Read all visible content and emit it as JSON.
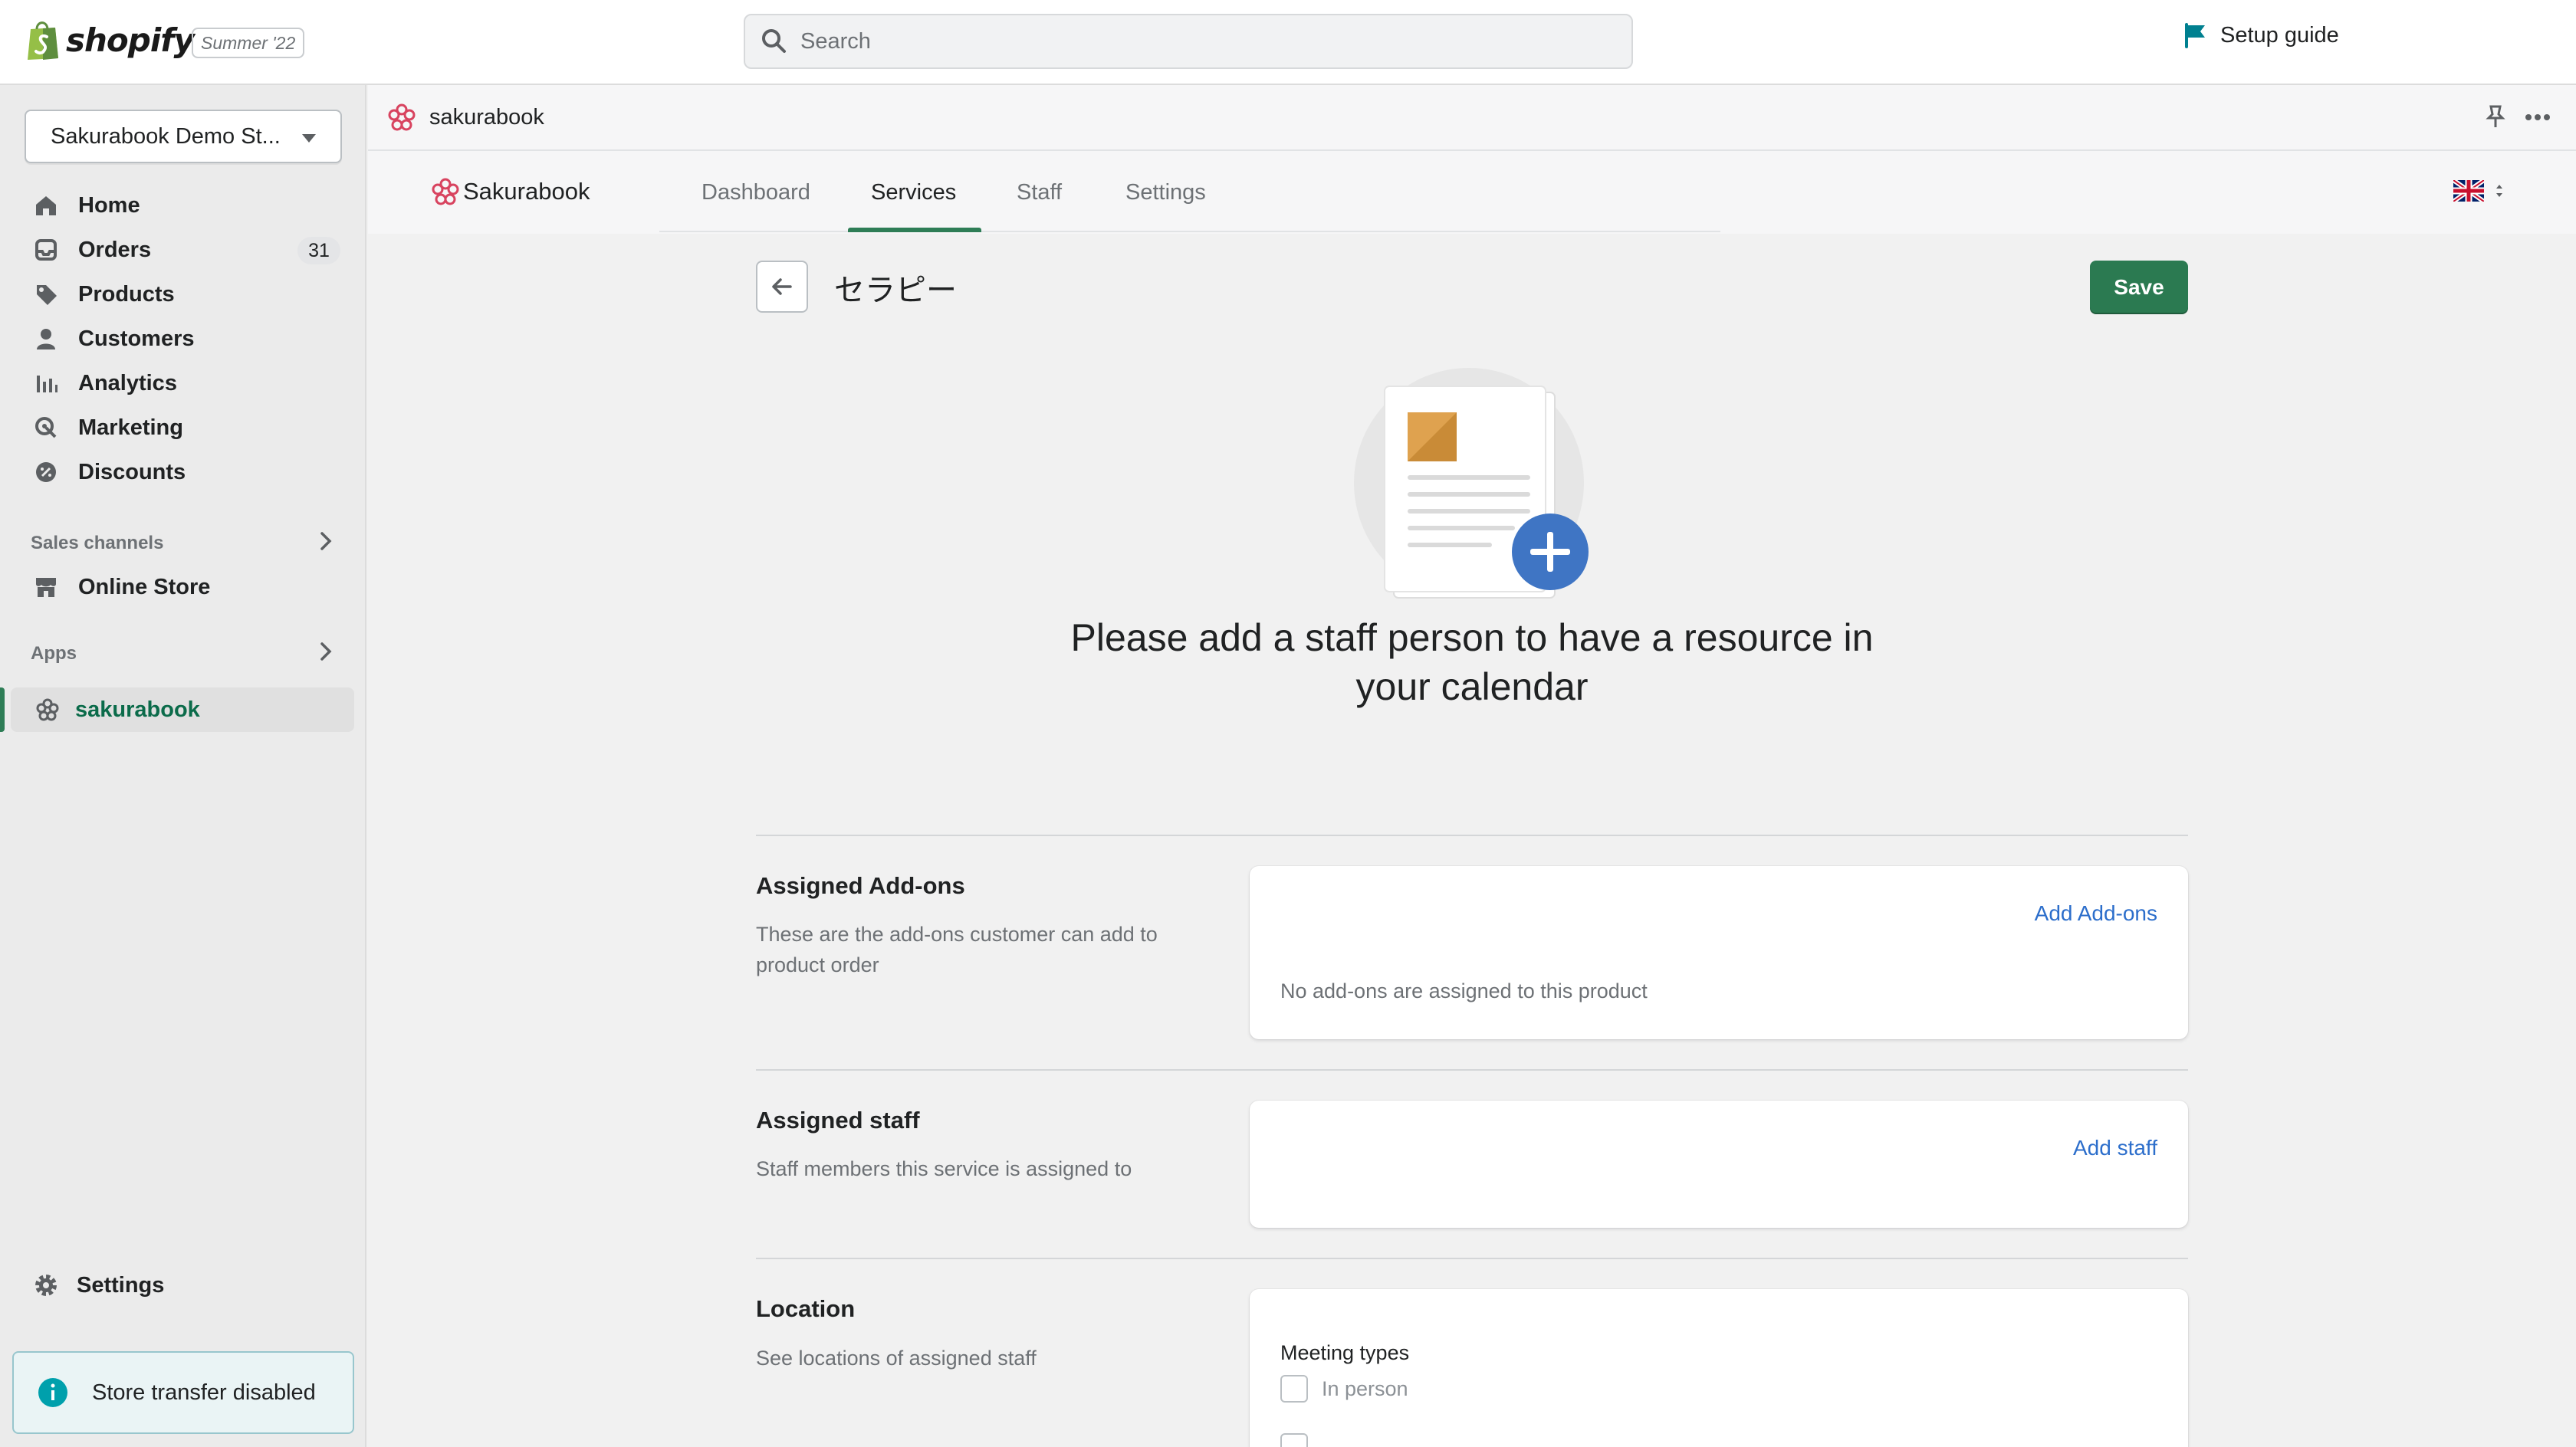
{
  "topbar": {
    "logo_text": "shopify",
    "edition": "Summer '22",
    "search_placeholder": "Search",
    "setup_guide": "Setup guide"
  },
  "sidebar": {
    "store_name": "Sakurabook Demo St...",
    "nav": [
      {
        "label": "Home",
        "icon": "home-icon"
      },
      {
        "label": "Orders",
        "icon": "orders-icon",
        "badge": "31"
      },
      {
        "label": "Products",
        "icon": "tag-icon"
      },
      {
        "label": "Customers",
        "icon": "person-icon"
      },
      {
        "label": "Analytics",
        "icon": "bar-chart-icon"
      },
      {
        "label": "Marketing",
        "icon": "marketing-icon"
      },
      {
        "label": "Discounts",
        "icon": "discount-icon"
      }
    ],
    "sales_channels_heading": "Sales channels",
    "online_store": "Online Store",
    "apps_heading": "Apps",
    "active_app": "sakurabook",
    "settings": "Settings",
    "transfer_notice": "Store transfer disabled"
  },
  "app_header": {
    "app_name": "sakurabook"
  },
  "tabs": {
    "brand": "Sakurabook",
    "items": [
      "Dashboard",
      "Services",
      "Staff",
      "Settings"
    ],
    "active": "Services"
  },
  "main": {
    "title": "セラピー",
    "save_label": "Save",
    "empty_heading": "Please add a staff person to have a resource in your calendar",
    "addons": {
      "title": "Assigned Add-ons",
      "description": "These are the add-ons customer can add to product order",
      "link": "Add Add-ons",
      "empty_text": "No add-ons are assigned to this product"
    },
    "staff": {
      "title": "Assigned staff",
      "description": "Staff members this service is assigned to",
      "link": "Add staff"
    },
    "location": {
      "title": "Location",
      "description": "See locations of assigned staff",
      "meeting_types_label": "Meeting types",
      "options": [
        "In person"
      ]
    }
  },
  "colors": {
    "accent_green": "#2b7a51",
    "link_blue": "#2c6ecb",
    "sakura_pink": "#d8435f"
  }
}
